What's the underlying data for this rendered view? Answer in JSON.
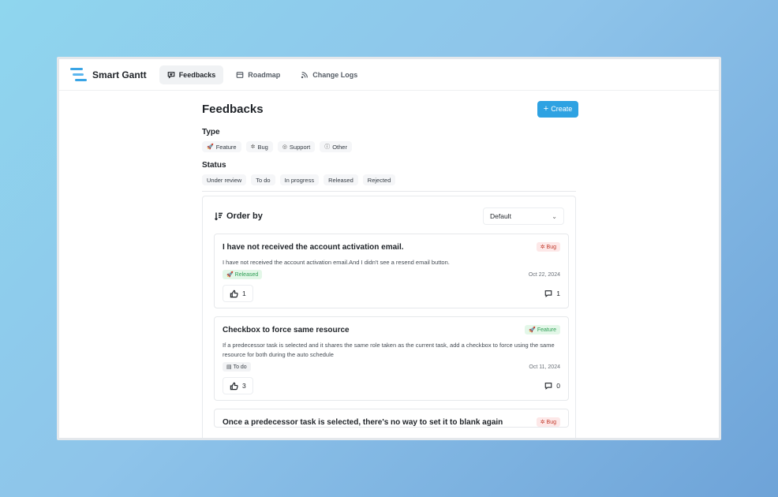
{
  "nav": {
    "app_name": "Smart Gantt",
    "tabs": [
      {
        "label": "Feedbacks",
        "icon": "message-square-icon",
        "active": true
      },
      {
        "label": "Roadmap",
        "icon": "map-icon",
        "active": false
      },
      {
        "label": "Change Logs",
        "icon": "rss-icon",
        "active": false
      }
    ]
  },
  "page": {
    "title": "Feedbacks",
    "create_label": "Create"
  },
  "filters": {
    "type_label": "Type",
    "types": [
      {
        "label": "Feature",
        "icon": "rocket-icon"
      },
      {
        "label": "Bug",
        "icon": "bug-icon"
      },
      {
        "label": "Support",
        "icon": "support-icon"
      },
      {
        "label": "Other",
        "icon": "help-circle-icon"
      }
    ],
    "status_label": "Status",
    "statuses": [
      "Under review",
      "To do",
      "In progress",
      "Released",
      "Rejected"
    ]
  },
  "order": {
    "label": "Order by",
    "value": "Default"
  },
  "feedbacks": [
    {
      "title": "I have not received the account activation email.",
      "type": "Bug",
      "description": "I have not received the account activation email.And I didn't see a resend email button.",
      "status": "Released",
      "date": "Oct 22, 2024",
      "votes": "1",
      "comments": "1"
    },
    {
      "title": "Checkbox to force same resource",
      "type": "Feature",
      "description": "If a predecessor task is selected and it shares the same role taken as the current task, add a checkbox to force using the same resource for both during the auto schedule",
      "status": "To do",
      "date": "Oct 11, 2024",
      "votes": "3",
      "comments": "0"
    },
    {
      "title": "Once a predecessor task is selected, there's no way to set it to blank again",
      "type": "Bug"
    }
  ],
  "colors": {
    "accent": "#2ea2e2",
    "bug_bg": "#fde8e8",
    "feature_bg": "#e3f7e8"
  }
}
